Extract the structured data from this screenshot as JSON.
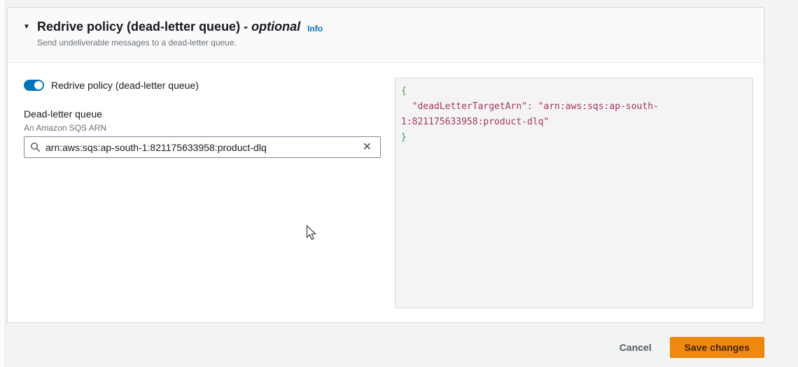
{
  "panel": {
    "expander_glyph": "▼",
    "title": "Redrive policy (dead-letter queue)",
    "title_suffix": "- optional",
    "info_link": "Info",
    "description": "Send undeliverable messages to a dead-letter queue."
  },
  "form": {
    "toggle_label": "Redrive policy (dead-letter queue)",
    "toggle_state": "on",
    "field_label": "Dead-letter queue",
    "field_hint": "An Amazon SQS ARN",
    "input_value": "arn:aws:sqs:ap-south-1:821175633958:product-dlq",
    "clear_glyph": "✕"
  },
  "json_preview": {
    "line1": "{",
    "line2": "  \"deadLetterTargetArn\": \"arn:aws:sqs:ap-south-",
    "line3": "1:821175633958:product-dlq\"",
    "line4": "}"
  },
  "footer": {
    "cancel_label": "Cancel",
    "save_label": "Save changes"
  },
  "colors": {
    "link_blue": "#0073bb",
    "toggle_blue": "#0073bb",
    "save_orange": "#f0870e",
    "save_text": "#43260b",
    "token_string": "#a6365a",
    "token_brace": "#2e9e4f",
    "header_bg": "#fafafa",
    "page_bg": "#f2f3f3"
  }
}
